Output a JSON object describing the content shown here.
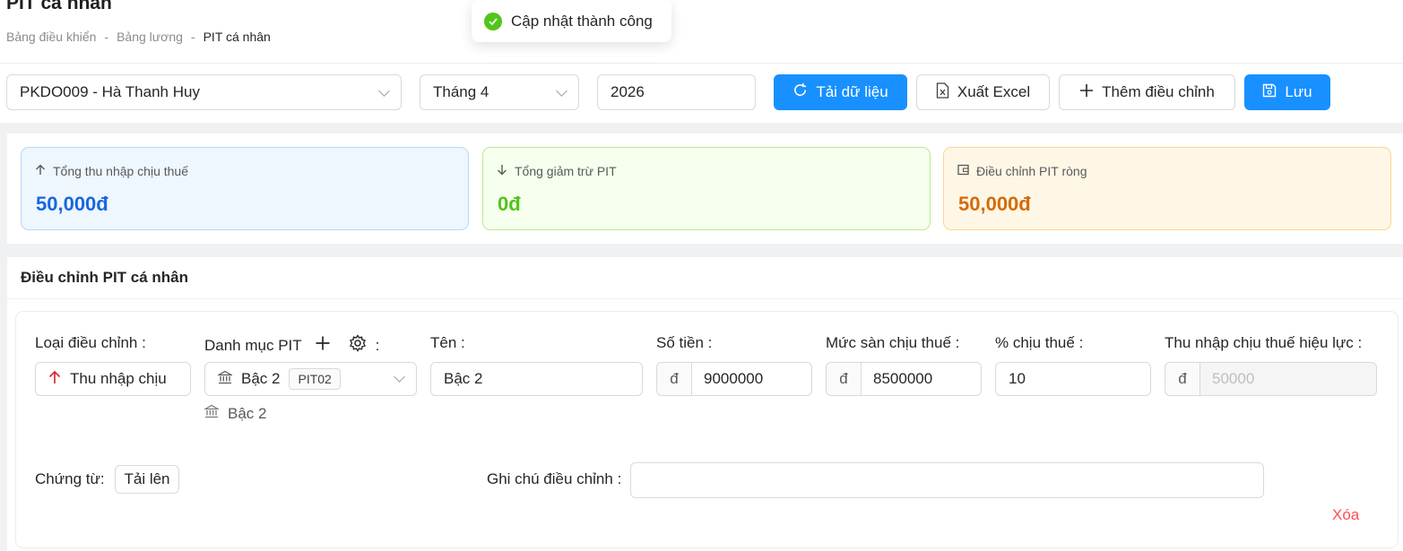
{
  "header": {
    "title": "PIT cá nhân",
    "breadcrumb": [
      "Bảng điều khiển",
      "-",
      "Bảng lương",
      "-",
      "PIT cá nhân"
    ]
  },
  "toast": {
    "message": "Cập nhật thành công"
  },
  "filters": {
    "employee": "PKDO009 - Hà Thanh Huy",
    "month": "Tháng 4",
    "year": "2026"
  },
  "toolbar": {
    "reload_label": "Tải dữ liệu",
    "export_label": "Xuất Excel",
    "add_label": "Thêm điều chỉnh",
    "save_label": "Lưu"
  },
  "summary": [
    {
      "label": "Tổng thu nhập chịu thuế",
      "value": "50,000đ",
      "accent": "#1668dc"
    },
    {
      "label": "Tổng giảm trừ PIT",
      "value": "0đ",
      "accent": "#52c41a"
    },
    {
      "label": "Điều chỉnh PIT ròng",
      "value": "50,000đ",
      "accent": "#d46b08"
    }
  ],
  "adjustment": {
    "section_title": "Điều chỉnh PIT cá nhân",
    "labels": {
      "type": "Loại điều chỉnh",
      "category": "Danh mục PIT",
      "category_colon": ":",
      "name": "Tên",
      "amount": "Số tiền",
      "floor": "Mức sàn chịu thuế",
      "percent": "% chịu thuế",
      "effective": "Thu nhập chịu thuế hiệu lực",
      "voucher": "Chứng từ",
      "note": "Ghi chú điều chỉnh"
    },
    "colon": ":",
    "type_value": "Thu nhập chịu",
    "category_value": "Bậc 2",
    "category_code": "PIT02",
    "category_hint": "Bậc 2",
    "name_value": "Bậc 2",
    "currency": "đ",
    "amount_value": "9000000",
    "floor_value": "8500000",
    "percent_value": "10",
    "effective_placeholder": "50000",
    "upload_label": "Tải lên",
    "note_value": "",
    "delete_label": "Xóa"
  }
}
